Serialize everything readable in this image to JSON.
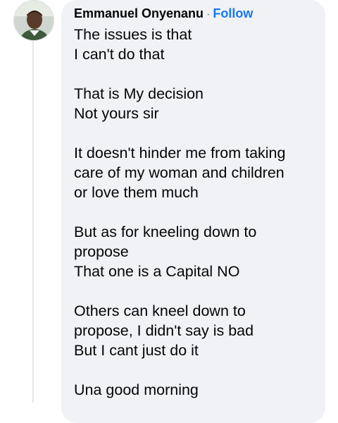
{
  "comment": {
    "author": "Emmanuel Onyenanu",
    "separator": "·",
    "follow_label": "Follow",
    "lines": [
      "The issues is that",
      "I can't do that",
      "",
      "That is My decision",
      "Not yours sir",
      "",
      "It doesn't hinder me from taking",
      "care of my woman and children",
      "or love them much",
      "",
      "But as for kneeling down to",
      "propose",
      "That one is a Capital NO",
      "",
      "Others can kneel down to",
      "propose, I didn't say is bad",
      "But I cant just do it",
      "",
      "Una good morning"
    ]
  },
  "colors": {
    "bubble": "#f0f2f5",
    "follow": "#1877f2",
    "text": "#050505",
    "thread_line": "#e4e6eb"
  },
  "icons": {
    "avatar": "profile-photo"
  }
}
